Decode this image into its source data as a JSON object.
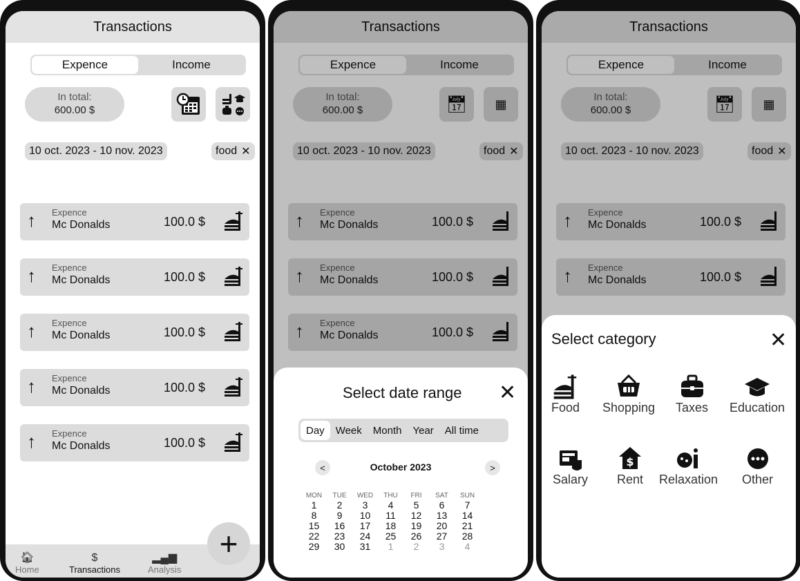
{
  "header": {
    "title": "Transactions"
  },
  "toggle": {
    "expence": "Expence",
    "income": "Income"
  },
  "total": {
    "label": "In total:",
    "value": "600.00 $"
  },
  "filters": {
    "date_range": "10 oct. 2023 - 10 nov. 2023",
    "category": "food"
  },
  "transactions": [
    {
      "kind": "Expence",
      "name": "Mc Donalds",
      "amount": "100.0 $",
      "icon": "food-icon"
    },
    {
      "kind": "Expence",
      "name": "Mc Donalds",
      "amount": "100.0 $",
      "icon": "food-icon"
    },
    {
      "kind": "Expence",
      "name": "Mc Donalds",
      "amount": "100.0 $",
      "icon": "food-icon"
    },
    {
      "kind": "Expence",
      "name": "Mc Donalds",
      "amount": "100.0 $",
      "icon": "food-icon"
    },
    {
      "kind": "Expence",
      "name": "Mc Donalds",
      "amount": "100.0 $",
      "icon": "food-icon"
    }
  ],
  "tabbar": {
    "home": "Home",
    "transactions": "Transactions",
    "analysis": "Analysis"
  },
  "date_sheet": {
    "title": "Select date range",
    "ranges": [
      "Day",
      "Week",
      "Month",
      "Year",
      "All time"
    ],
    "month": "October 2023",
    "prev": "<",
    "next": ">",
    "weekdays": [
      "MON",
      "TUE",
      "WED",
      "THU",
      "FRI",
      "SAT",
      "SUN"
    ],
    "weeks": [
      [
        "1",
        "2",
        "3",
        "4",
        "5",
        "6",
        "7"
      ],
      [
        "8",
        "9",
        "10",
        "11",
        "12",
        "13",
        "14"
      ],
      [
        "15",
        "16",
        "17",
        "18",
        "19",
        "20",
        "21"
      ],
      [
        "22",
        "23",
        "24",
        "25",
        "26",
        "27",
        "28"
      ],
      [
        "29",
        "30",
        "31",
        "1",
        "2",
        "3",
        "4"
      ]
    ]
  },
  "category_sheet": {
    "title": "Select category",
    "categories": [
      {
        "label": "Food",
        "icon": "food-icon"
      },
      {
        "label": "Shopping",
        "icon": "shopping-basket-icon"
      },
      {
        "label": "Taxes",
        "icon": "briefcase-icon"
      },
      {
        "label": "Education",
        "icon": "graduation-cap-icon"
      },
      {
        "label": "Salary",
        "icon": "wallet-icon"
      },
      {
        "label": "Rent",
        "icon": "house-dollar-icon"
      },
      {
        "label": "Relaxation",
        "icon": "relaxation-icon"
      },
      {
        "label": "Other",
        "icon": "more-icon"
      }
    ]
  }
}
